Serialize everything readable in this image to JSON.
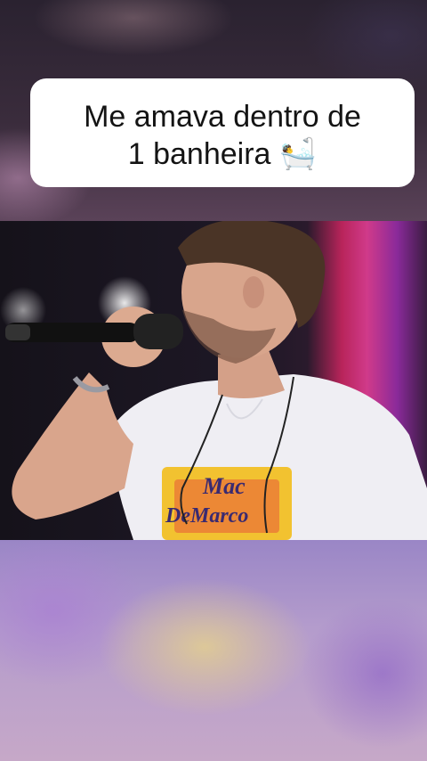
{
  "caption": {
    "line1": "Me amava dentro de",
    "line2": "1 banheira",
    "emoji": "🛀",
    "emoji_name": "bathtub-icon"
  },
  "video": {
    "shirt_text_line1": "Mac",
    "shirt_text_line2": "DeMarco"
  },
  "colors": {
    "caption_bg": "#ffffff",
    "caption_text": "#141414",
    "stage_pink": "#d03a8a",
    "shirt": "#efeef3",
    "shirt_print": "#f2c230"
  }
}
